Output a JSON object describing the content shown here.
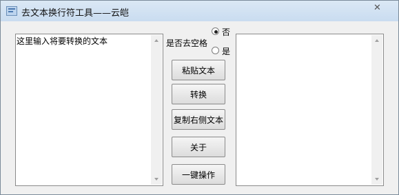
{
  "window": {
    "title": "去文本换行符工具——云皑"
  },
  "input": {
    "placeholder": "这里输入将要转换的文本"
  },
  "output": {
    "text": ""
  },
  "options": {
    "remove_space_label": "是否去空格",
    "no_label": "否",
    "yes_label": "是",
    "selected": "否"
  },
  "buttons": {
    "paste": "粘贴文本",
    "convert": "转换",
    "copy_right": "复制右侧文本",
    "about": "关于",
    "one_click": "一键操作"
  }
}
